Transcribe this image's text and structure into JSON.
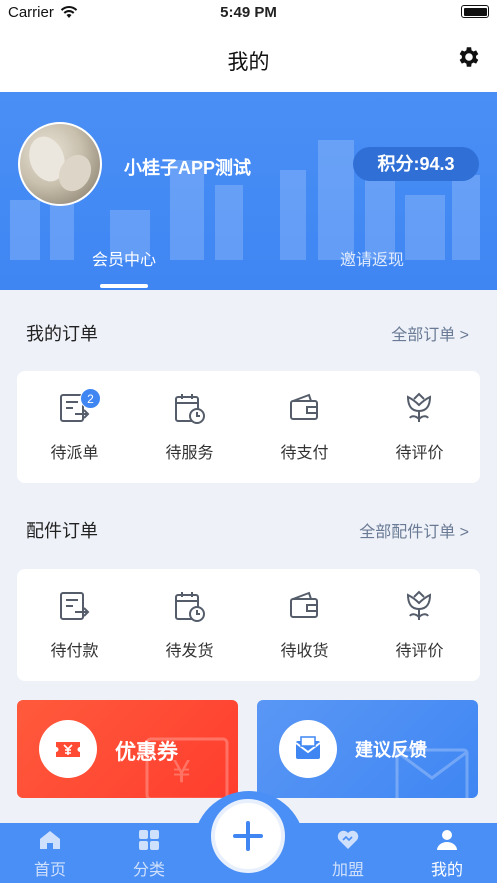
{
  "status_bar": {
    "carrier": "Carrier",
    "time": "5:49 PM"
  },
  "nav": {
    "title": "我的"
  },
  "profile": {
    "username": "小桂子APP测试",
    "points": "积分:94.3",
    "tabs": [
      "会员中心",
      "邀请返现"
    ]
  },
  "my_orders": {
    "title": "我的订单",
    "more": "全部订单 >",
    "items": [
      {
        "label": "待派单",
        "icon": "dispatch-icon",
        "badge": "2"
      },
      {
        "label": "待服务",
        "icon": "calendar-clock-icon"
      },
      {
        "label": "待支付",
        "icon": "wallet-icon"
      },
      {
        "label": "待评价",
        "icon": "flower-icon"
      }
    ]
  },
  "parts_orders": {
    "title": "配件订单",
    "more": "全部配件订单 >",
    "items": [
      {
        "label": "待付款",
        "icon": "dispatch-icon"
      },
      {
        "label": "待发货",
        "icon": "calendar-clock-icon"
      },
      {
        "label": "待收货",
        "icon": "wallet-icon"
      },
      {
        "label": "待评价",
        "icon": "flower-icon"
      }
    ]
  },
  "promos": {
    "coupon": "优惠券",
    "feedback": "建议反馈"
  },
  "tab_bar": {
    "items": [
      "首页",
      "分类",
      "加盟",
      "我的"
    ],
    "active": "我的"
  },
  "colors": {
    "primary": "#4a8ff5",
    "coupon": "#ff4a34",
    "icon_gray": "#555d6b"
  }
}
